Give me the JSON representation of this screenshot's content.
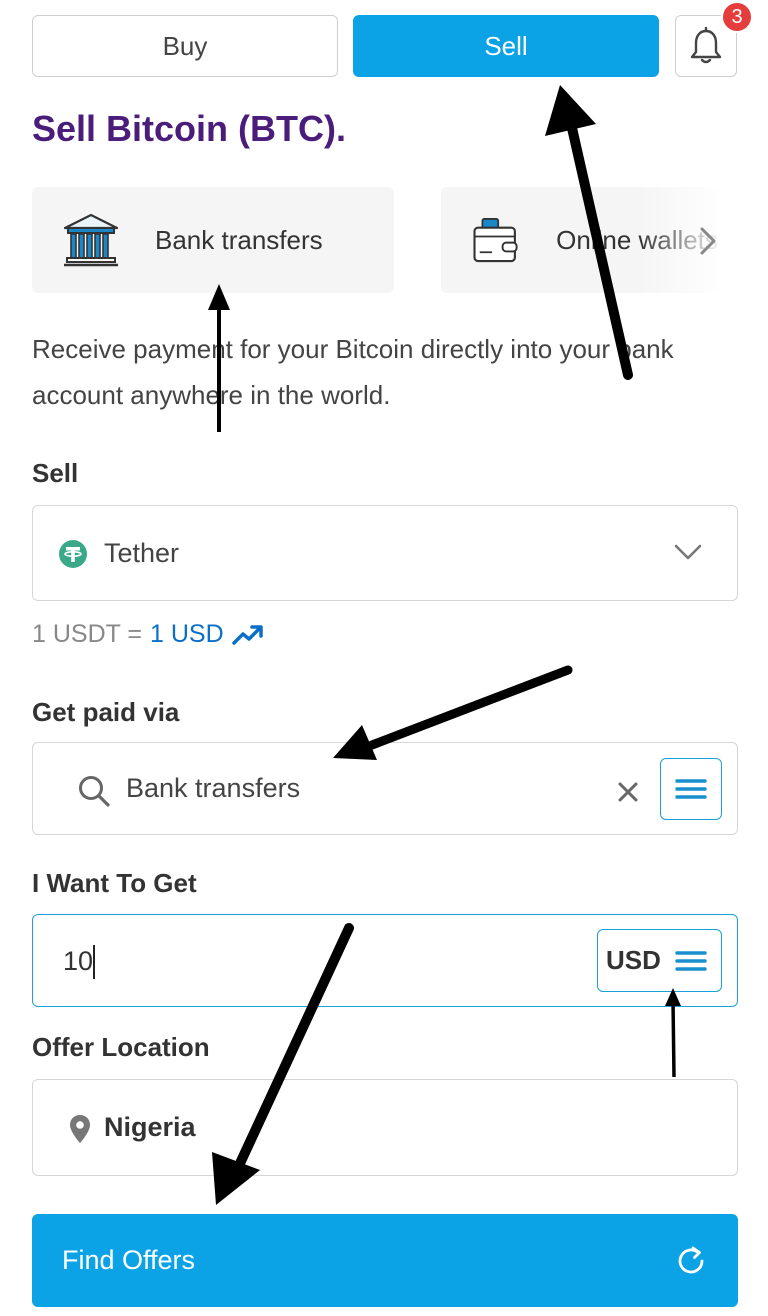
{
  "header": {
    "buy_label": "Buy",
    "sell_label": "Sell",
    "notification_count": "3",
    "bell_icon": "bell-icon"
  },
  "title": "Sell Bitcoin (BTC).",
  "payment_methods": [
    {
      "label": "Bank transfers",
      "icon": "bank-icon"
    },
    {
      "label": "Online wallets",
      "icon": "wallet-icon"
    }
  ],
  "description": "Receive payment for your Bitcoin directly into your bank account anywhere in the world.",
  "sell_field": {
    "label": "Sell",
    "value": "Tether",
    "icon": "tether-icon"
  },
  "rate": {
    "left": "1 USDT =",
    "right": "1 USD"
  },
  "paid_via": {
    "label": "Get paid via",
    "value": "Bank transfers"
  },
  "amount": {
    "label": "I Want To Get",
    "value": "10",
    "currency": "USD"
  },
  "location": {
    "label": "Offer Location",
    "value": "Nigeria"
  },
  "find_offers_label": "Find Offers",
  "colors": {
    "accent": "#0ba2e6",
    "title": "#4a1d7a",
    "badge": "#e53c3c",
    "link": "#0b6fc7"
  }
}
